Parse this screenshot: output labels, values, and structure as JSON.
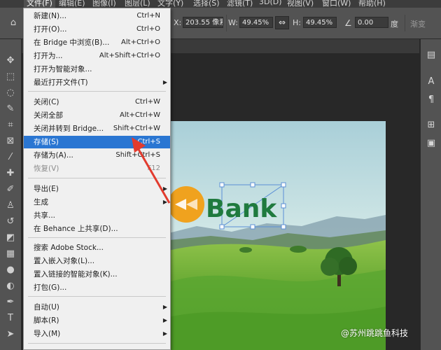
{
  "menubar": {
    "items": [
      "文件(F)",
      "编辑(E)",
      "图像(I)",
      "图层(L)",
      "文字(Y)",
      "选择(S)",
      "滤镜(T)",
      "3D(D)",
      "视图(V)",
      "窗口(W)",
      "帮助(H)"
    ]
  },
  "options": {
    "x_value": "203.55 像素",
    "w_label": "W:",
    "w_value": "49.45%",
    "h_label": "H:",
    "h_value": "49.45%",
    "angle_value": "0.00",
    "angle_unit": "度",
    "right_text": "渐变",
    "x_label": "X:",
    "link_glyph": "⇔"
  },
  "file_menu": {
    "items": [
      {
        "label": "新建(N)...",
        "shortcut": "Ctrl+N",
        "disabled": false
      },
      {
        "label": "打开(O)...",
        "shortcut": "Ctrl+O",
        "disabled": false
      },
      {
        "label": "在 Bridge 中浏览(B)...",
        "shortcut": "Alt+Ctrl+O",
        "disabled": false
      },
      {
        "label": "打开为...",
        "shortcut": "Alt+Shift+Ctrl+O",
        "disabled": false
      },
      {
        "label": "打开为智能对象...",
        "shortcut": "",
        "disabled": false
      },
      {
        "label": "最近打开文件(T)",
        "shortcut": "",
        "disabled": false,
        "submenu": true
      },
      {
        "label": "关闭(C)",
        "shortcut": "Ctrl+W",
        "disabled": false
      },
      {
        "label": "关闭全部",
        "shortcut": "Alt+Ctrl+W",
        "disabled": false
      },
      {
        "label": "关闭并转到 Bridge...",
        "shortcut": "Shift+Ctrl+W",
        "disabled": false
      },
      {
        "label": "存储(S)",
        "shortcut": "Ctrl+S",
        "disabled": false,
        "highlighted": true
      },
      {
        "label": "存储为(A)...",
        "shortcut": "Shift+Ctrl+S",
        "disabled": false
      },
      {
        "label": "恢复(V)",
        "shortcut": "F12",
        "disabled": true
      },
      {
        "label": "导出(E)",
        "shortcut": "",
        "disabled": false,
        "submenu": true
      },
      {
        "label": "生成",
        "shortcut": "",
        "disabled": false,
        "submenu": true
      },
      {
        "label": "共享...",
        "shortcut": "",
        "disabled": false
      },
      {
        "label": "在 Behance 上共享(D)...",
        "shortcut": "",
        "disabled": false
      },
      {
        "label": "搜索 Adobe Stock...",
        "shortcut": "",
        "disabled": false
      },
      {
        "label": "置入嵌入对象(L)...",
        "shortcut": "",
        "disabled": false
      },
      {
        "label": "置入链接的智能对象(K)...",
        "shortcut": "",
        "disabled": false
      },
      {
        "label": "打包(G)...",
        "shortcut": "",
        "disabled": false
      },
      {
        "label": "自动(U)",
        "shortcut": "",
        "disabled": false,
        "submenu": true
      },
      {
        "label": "脚本(R)",
        "shortcut": "",
        "disabled": false,
        "submenu": true
      },
      {
        "label": "导入(M)",
        "shortcut": "",
        "disabled": false,
        "submenu": true
      }
    ]
  },
  "canvas": {
    "logo_text": "Bank"
  },
  "watermark": "@苏州跳跳鱼科技",
  "colors": {
    "highlight": "#2a76d2",
    "logo_green": "#1f7a3e",
    "logo_orange": "#f0a21e",
    "arrow_red": "#e23b2e"
  }
}
